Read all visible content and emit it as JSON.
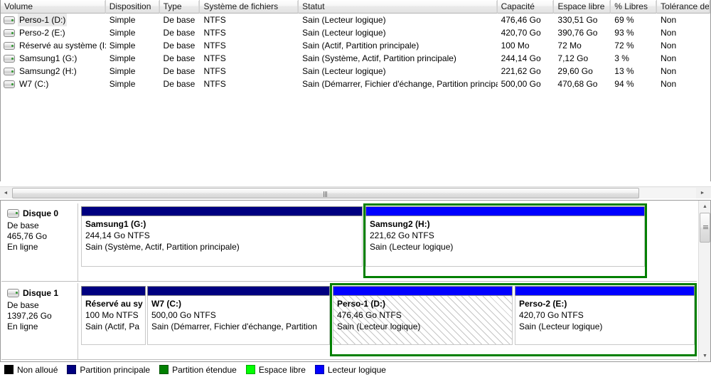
{
  "volume_list": {
    "columns": [
      {
        "key": "volume",
        "label": "Volume"
      },
      {
        "key": "layout",
        "label": "Disposition"
      },
      {
        "key": "type",
        "label": "Type"
      },
      {
        "key": "filesystem",
        "label": "Système de fichiers"
      },
      {
        "key": "status",
        "label": "Statut"
      },
      {
        "key": "capacity",
        "label": "Capacité"
      },
      {
        "key": "free",
        "label": "Espace libre"
      },
      {
        "key": "pct_free",
        "label": "% Libres"
      },
      {
        "key": "fault_tolerance",
        "label": "Tolérance de"
      }
    ],
    "rows": [
      {
        "icon": "drive-icon",
        "volume": "Perso-1 (D:)",
        "layout": "Simple",
        "type": "De base",
        "filesystem": "NTFS",
        "status": "Sain (Lecteur logique)",
        "capacity": "476,46 Go",
        "free": "330,51 Go",
        "pct_free": "69 %",
        "fault_tolerance": "Non",
        "selected": true
      },
      {
        "icon": "drive-icon",
        "volume": "Perso-2 (E:)",
        "layout": "Simple",
        "type": "De base",
        "filesystem": "NTFS",
        "status": "Sain (Lecteur logique)",
        "capacity": "420,70 Go",
        "free": "390,76 Go",
        "pct_free": "93 %",
        "fault_tolerance": "Non",
        "selected": false
      },
      {
        "icon": "drive-icon",
        "volume": "Réservé au système (I:)",
        "layout": "Simple",
        "type": "De base",
        "filesystem": "NTFS",
        "status": "Sain (Actif, Partition principale)",
        "capacity": "100 Mo",
        "free": "72 Mo",
        "pct_free": "72 %",
        "fault_tolerance": "Non",
        "selected": false
      },
      {
        "icon": "drive-icon",
        "volume": "Samsung1 (G:)",
        "layout": "Simple",
        "type": "De base",
        "filesystem": "NTFS",
        "status": "Sain (Système, Actif, Partition principale)",
        "capacity": "244,14 Go",
        "free": "7,12 Go",
        "pct_free": "3 %",
        "fault_tolerance": "Non",
        "selected": false
      },
      {
        "icon": "drive-icon",
        "volume": "Samsung2 (H:)",
        "layout": "Simple",
        "type": "De base",
        "filesystem": "NTFS",
        "status": "Sain (Lecteur logique)",
        "capacity": "221,62 Go",
        "free": "29,60 Go",
        "pct_free": "13 %",
        "fault_tolerance": "Non",
        "selected": false
      },
      {
        "icon": "drive-icon",
        "volume": "W7 (C:)",
        "layout": "Simple",
        "type": "De base",
        "filesystem": "NTFS",
        "status": "Sain (Démarrer, Fichier d'échange, Partition principale)",
        "capacity": "500,00 Go",
        "free": "470,68 Go",
        "pct_free": "94 %",
        "fault_tolerance": "Non",
        "selected": false
      }
    ]
  },
  "horizontal_scrollbar": {
    "left_arrow": "◄",
    "right_arrow": "►"
  },
  "vertical_scrollbar": {
    "up_arrow": "▲",
    "down_arrow": "▼"
  },
  "disks": [
    {
      "icon": "disk-icon",
      "name": "Disque 0",
      "type": "De base",
      "size": "465,76 Go",
      "state": "En ligne",
      "partitions": [
        {
          "name": "Samsung1  (G:)",
          "size": "244,14 Go NTFS",
          "status": "Sain (Système, Actif, Partition principale)",
          "kind": "primary",
          "hatched": false,
          "extended": false
        },
        {
          "name": "Samsung2  (H:)",
          "size": "221,62 Go NTFS",
          "status": "Sain (Lecteur logique)",
          "kind": "logical",
          "hatched": false,
          "extended": true
        }
      ]
    },
    {
      "icon": "disk-icon",
      "name": "Disque 1",
      "type": "De base",
      "size": "1397,26 Go",
      "state": "En ligne",
      "partitions": [
        {
          "name": "Réservé au sy",
          "size": "100 Mo NTFS",
          "status": "Sain (Actif, Pa",
          "kind": "primary",
          "hatched": false,
          "extended": false
        },
        {
          "name": "W7  (C:)",
          "size": "500,00 Go NTFS",
          "status": "Sain (Démarrer, Fichier d'échange, Partition",
          "kind": "primary",
          "hatched": false,
          "extended": false
        },
        {
          "name": "Perso-1  (D:)",
          "size": "476,46 Go NTFS",
          "status": "Sain (Lecteur logique)",
          "kind": "logical",
          "hatched": true,
          "extended": true
        },
        {
          "name": "Perso-2  (E:)",
          "size": "420,70 Go NTFS",
          "status": "Sain (Lecteur logique)",
          "kind": "logical",
          "hatched": false,
          "extended": true
        }
      ]
    }
  ],
  "legend": [
    {
      "label": "Non alloué",
      "color": "#000000"
    },
    {
      "label": "Partition principale",
      "color": "#000080"
    },
    {
      "label": "Partition étendue",
      "color": "#008000"
    },
    {
      "label": "Espace libre",
      "color": "#00ff00"
    },
    {
      "label": "Lecteur logique",
      "color": "#0000ff"
    }
  ]
}
